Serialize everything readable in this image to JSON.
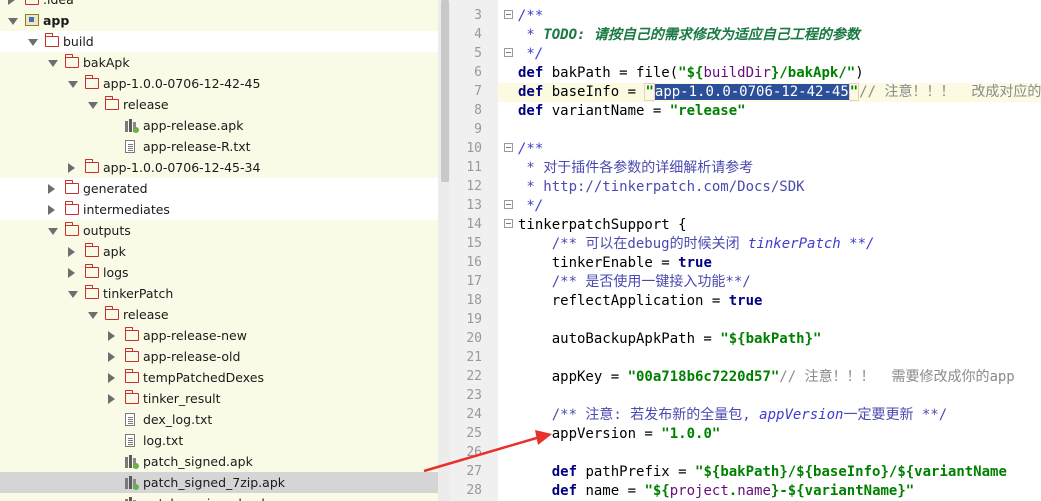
{
  "tree": {
    "rows": [
      {
        "label": ".idea",
        "indent": 1,
        "icon": "folder-icon",
        "arrow": "closed",
        "bg": "yellow"
      },
      {
        "label": "app",
        "indent": 1,
        "icon": "module-folder-icon",
        "arrow": "open",
        "bg": "yellow",
        "bold": true
      },
      {
        "label": "build",
        "indent": 2,
        "icon": "folder-icon",
        "arrow": "open",
        "bg": "white"
      },
      {
        "label": "bakApk",
        "indent": 3,
        "icon": "folder-icon",
        "arrow": "open",
        "bg": "yellow"
      },
      {
        "label": "app-1.0.0-0706-12-42-45",
        "indent": 4,
        "icon": "folder-icon",
        "arrow": "open",
        "bg": "yellow"
      },
      {
        "label": "release",
        "indent": 5,
        "icon": "folder-icon",
        "arrow": "open",
        "bg": "yellow"
      },
      {
        "label": "app-release.apk",
        "indent": 6,
        "icon": "apk-icon",
        "arrow": "none",
        "bg": "yellow"
      },
      {
        "label": "app-release-R.txt",
        "indent": 6,
        "icon": "file-icon",
        "arrow": "none",
        "bg": "yellow"
      },
      {
        "label": "app-1.0.0-0706-12-45-34",
        "indent": 4,
        "icon": "folder-icon",
        "arrow": "closed",
        "bg": "yellow"
      },
      {
        "label": "generated",
        "indent": 3,
        "icon": "folder-icon",
        "arrow": "closed",
        "bg": "white"
      },
      {
        "label": "intermediates",
        "indent": 3,
        "icon": "folder-icon",
        "arrow": "closed",
        "bg": "white"
      },
      {
        "label": "outputs",
        "indent": 3,
        "icon": "folder-icon",
        "arrow": "open",
        "bg": "yellow"
      },
      {
        "label": "apk",
        "indent": 4,
        "icon": "folder-icon",
        "arrow": "closed",
        "bg": "yellow"
      },
      {
        "label": "logs",
        "indent": 4,
        "icon": "folder-icon",
        "arrow": "closed",
        "bg": "yellow"
      },
      {
        "label": "tinkerPatch",
        "indent": 4,
        "icon": "folder-icon",
        "arrow": "open",
        "bg": "yellow"
      },
      {
        "label": "release",
        "indent": 5,
        "icon": "folder-icon",
        "arrow": "open",
        "bg": "yellow"
      },
      {
        "label": "app-release-new",
        "indent": 6,
        "icon": "folder-icon",
        "arrow": "closed",
        "bg": "yellow"
      },
      {
        "label": "app-release-old",
        "indent": 6,
        "icon": "folder-icon",
        "arrow": "closed",
        "bg": "yellow"
      },
      {
        "label": "tempPatchedDexes",
        "indent": 6,
        "icon": "folder-icon",
        "arrow": "closed",
        "bg": "yellow"
      },
      {
        "label": "tinker_result",
        "indent": 6,
        "icon": "folder-icon",
        "arrow": "closed",
        "bg": "yellow"
      },
      {
        "label": "dex_log.txt",
        "indent": 6,
        "icon": "file-icon",
        "arrow": "none",
        "bg": "yellow"
      },
      {
        "label": "log.txt",
        "indent": 6,
        "icon": "file-icon",
        "arrow": "none",
        "bg": "yellow"
      },
      {
        "label": "patch_signed.apk",
        "indent": 6,
        "icon": "apk-icon",
        "arrow": "none",
        "bg": "yellow"
      },
      {
        "label": "patch_signed_7zip.apk",
        "indent": 6,
        "icon": "apk-icon",
        "arrow": "none",
        "bg": "selected"
      },
      {
        "label": "patch_unsigned.apk",
        "indent": 6,
        "icon": "apk-icon",
        "arrow": "none",
        "bg": "yellow"
      }
    ]
  },
  "editor": {
    "line_numbers": [
      "3",
      "4",
      "5",
      "6",
      "7",
      "8",
      "9",
      "10",
      "11",
      "12",
      "13",
      "14",
      "15",
      "16",
      "17",
      "18",
      "19",
      "20",
      "21",
      "22",
      "23",
      "24",
      "25",
      "26",
      "27",
      "28"
    ],
    "text": {
      "l3": "/**",
      "l4_a": " * ",
      "l4_b": "TODO: 请按自己的需求修改为适应自己工程的参数",
      "l5": " */",
      "l6_a": "def",
      "l6_b": " bakPath = ",
      "l6_c": "file",
      "l6_d": "(",
      "l6_e": "\"${",
      "l6_f": "buildDir",
      "l6_g": "}/bakApk/\"",
      "l6_h": ")",
      "l7_a": "def",
      "l7_b": " baseInfo = ",
      "l7_c": "\"",
      "l7_d": "app-1.0.0-0706-12-42-45",
      "l7_e": "\"",
      "l7_f": "// 注意！！！  改成对应的",
      "l8_a": "def",
      "l8_b": " variantName = ",
      "l8_c": "\"release\"",
      "l10": "/**",
      "l11": " * 对于插件各参数的详细解析请参考",
      "l12": " * http://tinkerpatch.com/Docs/SDK",
      "l13": " */",
      "l14": "tinkerpatchSupport {",
      "l15_a": "    /** 可以在debug的时候关闭 ",
      "l15_b": "tinkerPatch **/",
      "l16_a": "    tinkerEnable = ",
      "l16_b": "true",
      "l17": "    /** 是否使用一键接入功能**/",
      "l18_a": "    reflectApplication = ",
      "l18_b": "true",
      "l20_a": "    autoBackupApkPath = ",
      "l20_b": "\"${bakPath}\"",
      "l22_a": "    appKey = ",
      "l22_b": "\"00a718b6c7220d57\"",
      "l22_c": "// 注意！！！  需要修改成你的app",
      "l24_a": "    /** 注意: 若发布新的全量包, ",
      "l24_b": "appVersion",
      "l24_c": "一定要更新 **/",
      "l25_a": "    appVersion = ",
      "l25_b": "\"1.0.0\"",
      "l27_a": "    def",
      "l27_b": " pathPrefix = ",
      "l27_c": "\"${bakPath}/${baseInfo}/${variantName",
      "l28_a": "    def",
      "l28_b": " name = ",
      "l28_c": "\"${",
      "l28_d": "project",
      "l28_e": ".",
      "l28_f": "name",
      "l28_g": "}-${variantName}\""
    }
  },
  "colors": {
    "keyword": "#000080",
    "string": "#008000",
    "comment": "#3d3dcf",
    "selection": "#2c4f9a",
    "arrow": "#e8302c",
    "highlight_row": "#fafbe6"
  }
}
